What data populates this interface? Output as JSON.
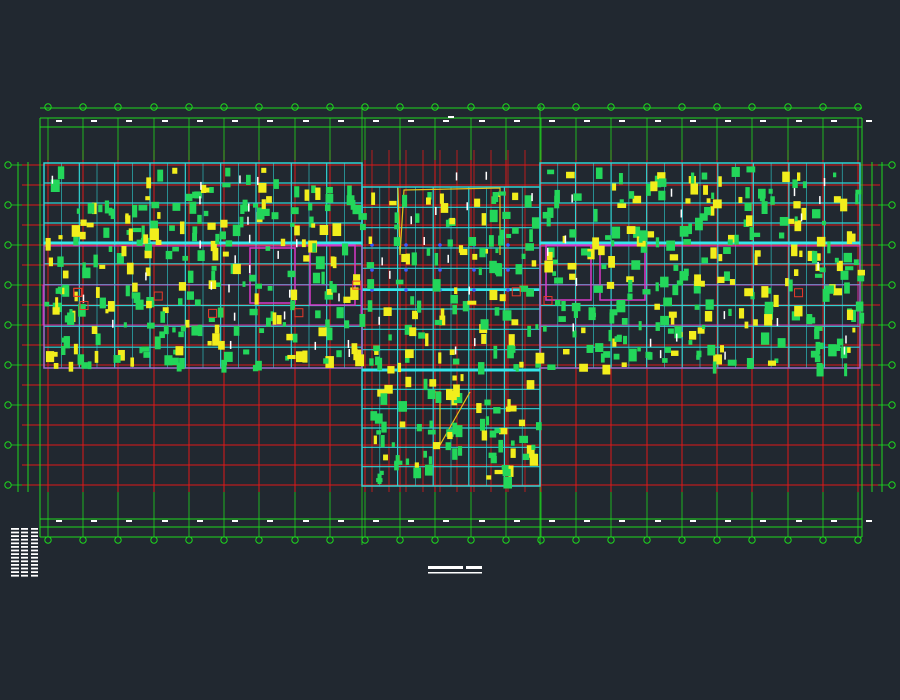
{
  "drawing": {
    "background": "#212830",
    "colors": {
      "axis": "#1ed81e",
      "grid": "#e01818",
      "beam": "#2fd2d2",
      "beam_main": "#34e6ea",
      "column": "#23d65a",
      "column_alt": "#f2ee1c",
      "wall": "#d838c8",
      "yellow_beam": "#e8c21a",
      "blue_node": "#3b5cff",
      "text": "#ffffff"
    },
    "axis_bubble_count_top": 24,
    "axis_bubble_count_side": 11,
    "legend_rows": 14,
    "grid_horizontal_lines": 10,
    "grid_vertical_lines": 24
  }
}
